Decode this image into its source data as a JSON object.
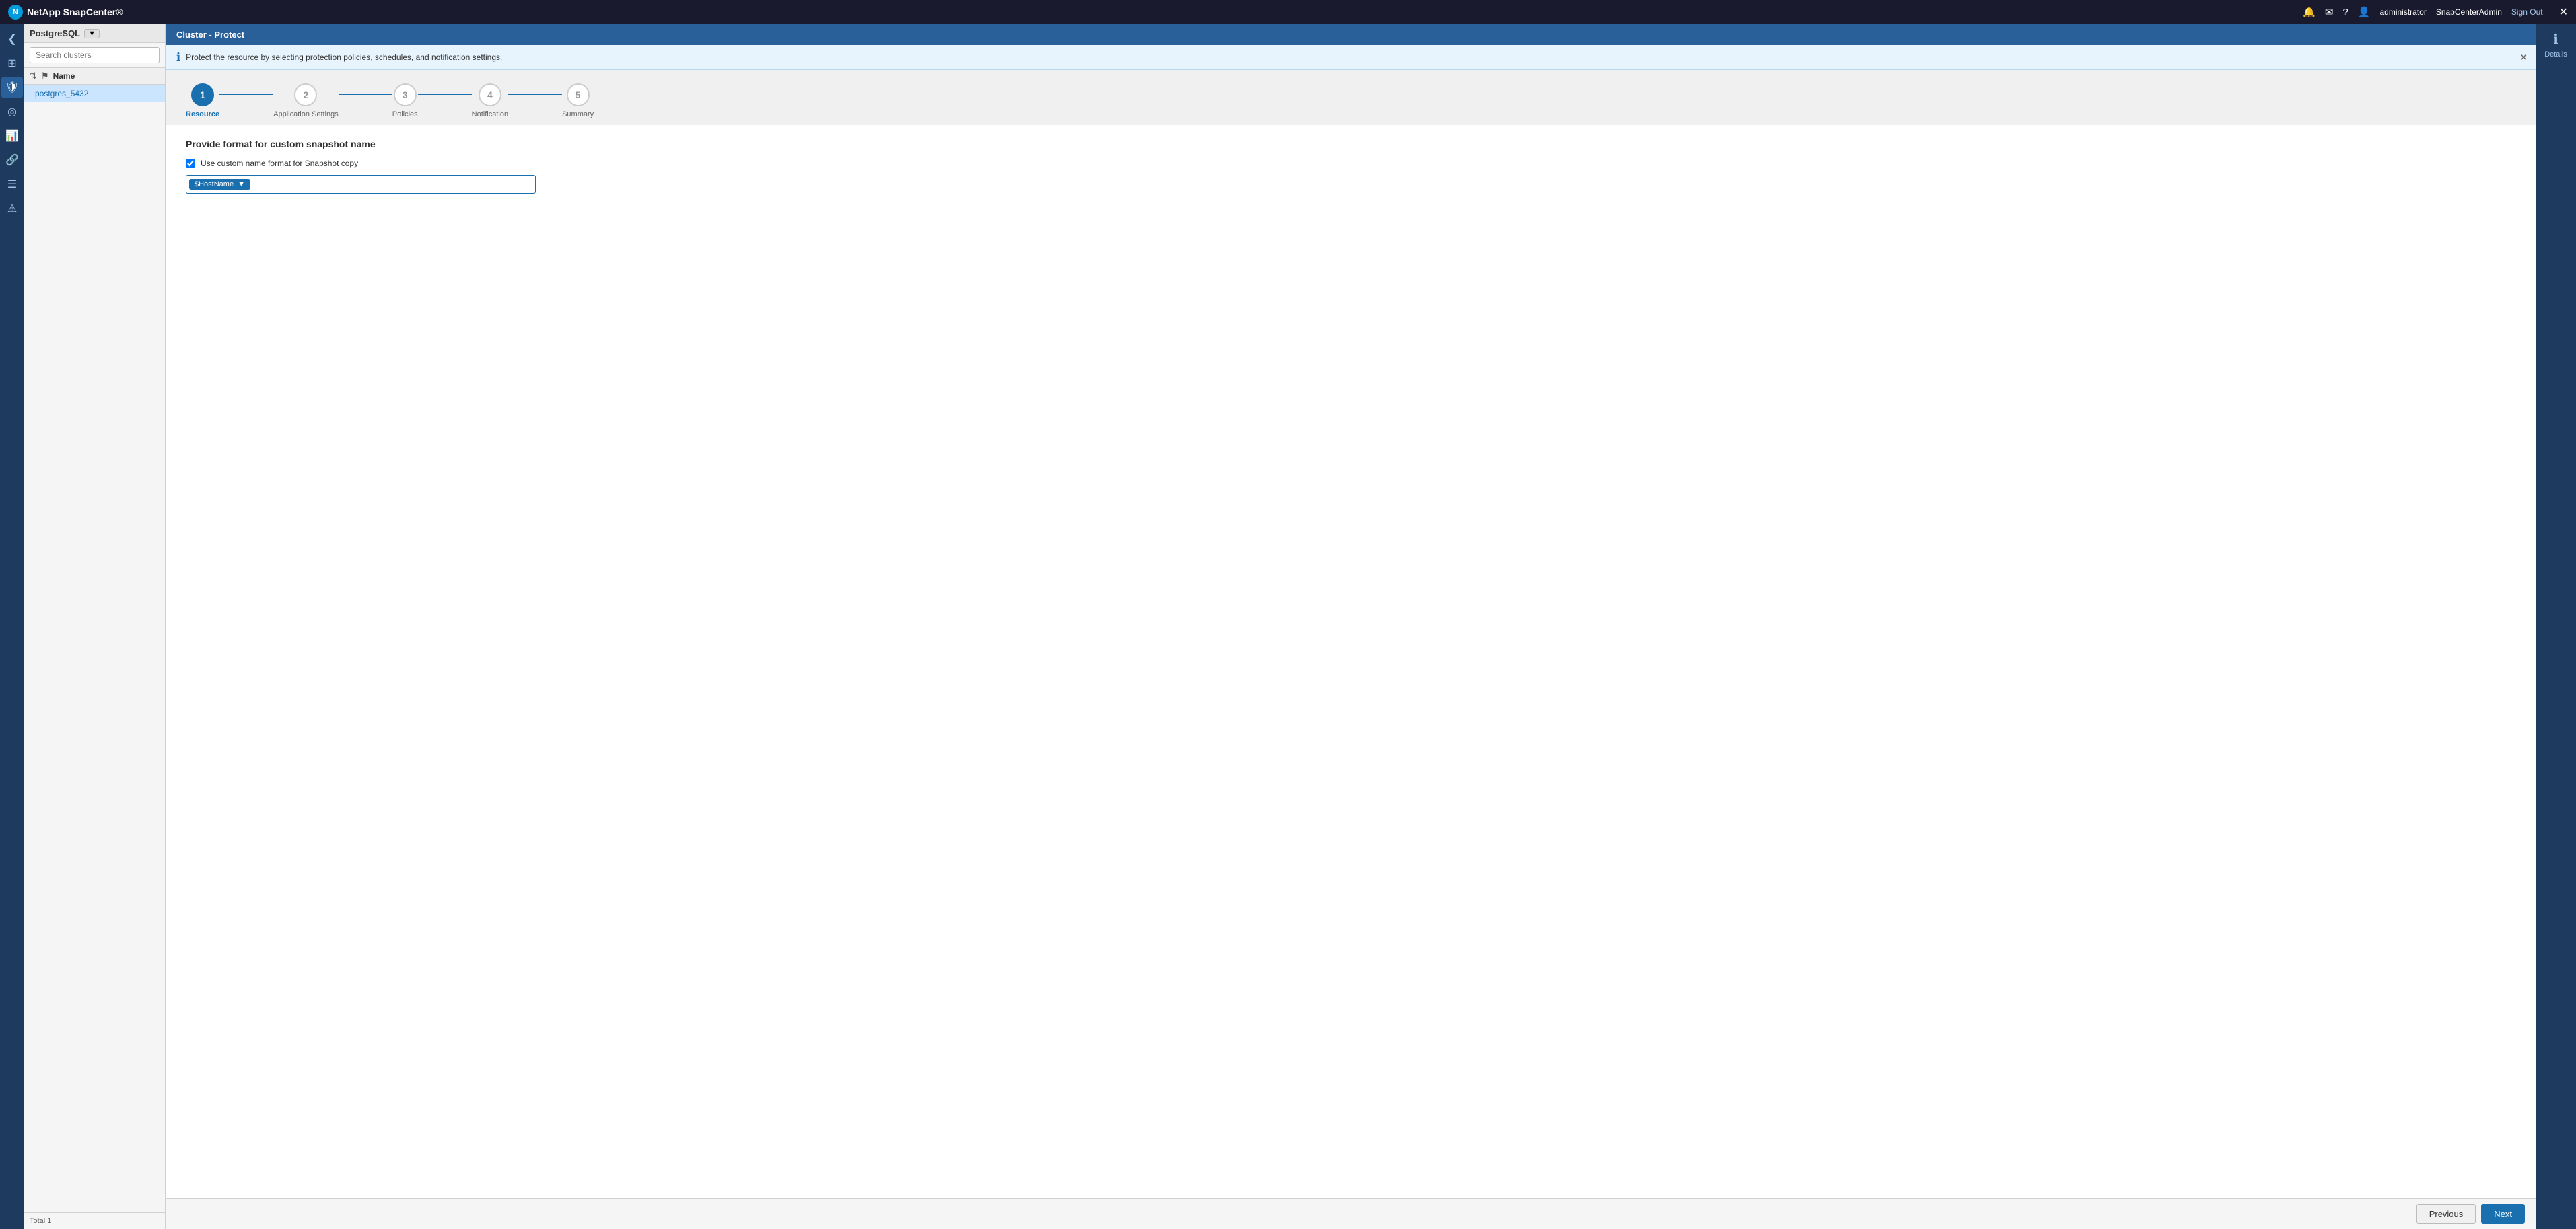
{
  "app": {
    "logo_text": "NetApp SnapCenter®",
    "header_right": {
      "bell_icon": "🔔",
      "mail_icon": "✉",
      "help_icon": "?",
      "user_icon": "👤",
      "user_name": "administrator",
      "org_name": "SnapCenterAdmin",
      "signout_label": "Sign Out",
      "close_icon": "✕"
    }
  },
  "left_nav": {
    "items": [
      {
        "icon": "❮",
        "name": "collapse-icon"
      },
      {
        "icon": "⊞",
        "name": "grid-icon"
      },
      {
        "icon": "🛡",
        "name": "protect-icon",
        "active": true
      },
      {
        "icon": "◎",
        "name": "monitor-icon"
      },
      {
        "icon": "📊",
        "name": "reports-icon"
      },
      {
        "icon": "⚙",
        "name": "topology-icon"
      },
      {
        "icon": "☰",
        "name": "settings-icon"
      },
      {
        "icon": "⚠",
        "name": "alerts-icon"
      }
    ]
  },
  "cluster_sidebar": {
    "db_label": "PostgreSQL",
    "db_tag_icon": "▼",
    "search_placeholder": "Search clusters",
    "table_header": {
      "sort_icon": "⇅",
      "flag_icon": "⚑",
      "name_label": "Name"
    },
    "clusters": [
      {
        "name": "postgres_5432",
        "selected": true
      }
    ],
    "footer": "Total 1"
  },
  "content_topbar": {
    "title": "Cluster - Protect"
  },
  "details_panel": {
    "icon": "ℹ",
    "label": "Details"
  },
  "info_bar": {
    "icon": "ℹ",
    "message": "Protect the resource by selecting protection policies, schedules, and notification settings.",
    "close_icon": "✕"
  },
  "stepper": {
    "steps": [
      {
        "number": "1",
        "label": "Resource",
        "state": "active"
      },
      {
        "number": "2",
        "label": "Application Settings",
        "state": "default"
      },
      {
        "number": "3",
        "label": "Policies",
        "state": "default"
      },
      {
        "number": "4",
        "label": "Notification",
        "state": "default"
      },
      {
        "number": "5",
        "label": "Summary",
        "state": "default"
      }
    ]
  },
  "form": {
    "section_title": "Provide format for custom snapshot name",
    "checkbox_label": "Use custom name format for Snapshot copy",
    "snapshot_tag": "$HostName",
    "snapshot_tag_close": "▼",
    "snapshot_input_value": ""
  },
  "bottom_bar": {
    "previous_label": "Previous",
    "next_label": "Next"
  }
}
